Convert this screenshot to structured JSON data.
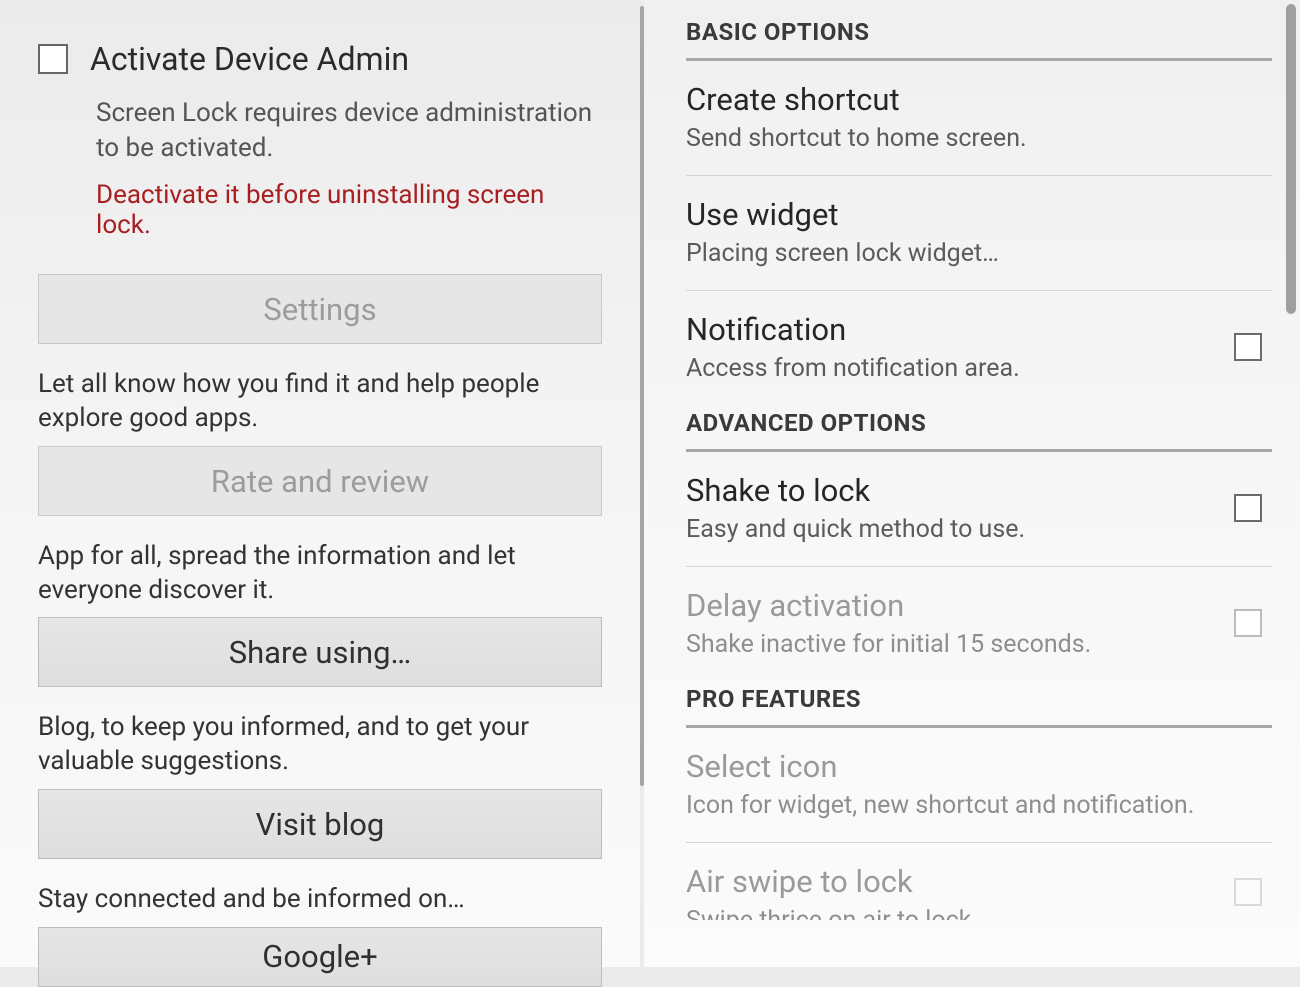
{
  "left": {
    "activate_admin_label": "Activate Device Admin",
    "activate_admin_desc": "Screen Lock requires device administration to be activated.",
    "activate_admin_warning": "Deactivate it before uninstalling screen lock.",
    "settings_btn": "Settings",
    "rate_desc": "Let all know how you find it and help people explore good apps.",
    "rate_btn": "Rate and review",
    "share_desc": "App for all, spread the information and let everyone discover it.",
    "share_btn": "Share using…",
    "blog_desc": "Blog, to keep you informed, and to get your valuable suggestions.",
    "blog_btn": "Visit blog",
    "gplus_desc": "Stay connected and be informed on…",
    "gplus_btn": "Google+"
  },
  "right": {
    "sections": {
      "basic": "BASIC OPTIONS",
      "advanced": "ADVANCED OPTIONS",
      "pro": "PRO FEATURES"
    },
    "items": {
      "create_shortcut": {
        "title": "Create shortcut",
        "sub": "Send shortcut to home screen."
      },
      "use_widget": {
        "title": "Use widget",
        "sub": "Placing screen lock widget…"
      },
      "notification": {
        "title": "Notification",
        "sub": "Access from notification area."
      },
      "shake_lock": {
        "title": "Shake to lock",
        "sub": "Easy and quick method to use."
      },
      "delay_activation": {
        "title": "Delay activation",
        "sub": "Shake inactive for initial 15 seconds."
      },
      "select_icon": {
        "title": "Select icon",
        "sub": "Icon for widget, new shortcut and notification."
      },
      "air_swipe": {
        "title": "Air swipe to lock",
        "sub": "Swipe thrice on air to lock."
      }
    }
  }
}
